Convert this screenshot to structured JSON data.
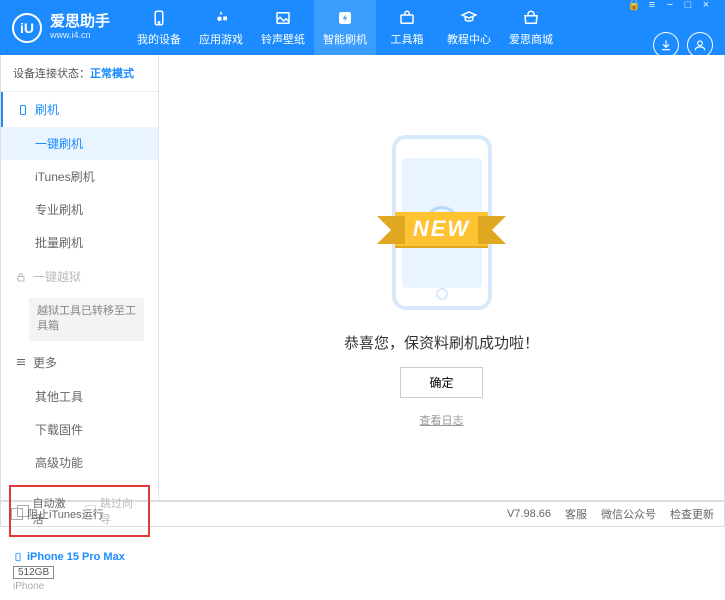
{
  "app": {
    "name": "爱思助手",
    "url": "www.i4.cn",
    "logo_letter": "iU"
  },
  "nav": [
    {
      "label": "我的设备"
    },
    {
      "label": "应用游戏"
    },
    {
      "label": "铃声壁纸"
    },
    {
      "label": "智能刷机"
    },
    {
      "label": "工具箱"
    },
    {
      "label": "教程中心"
    },
    {
      "label": "爱思商城"
    }
  ],
  "sidebar": {
    "conn_label": "设备连接状态：",
    "conn_mode": "正常模式",
    "flash_head": "刷机",
    "flash_items": [
      {
        "label": "一键刷机",
        "active": true
      },
      {
        "label": "iTunes刷机"
      },
      {
        "label": "专业刷机"
      },
      {
        "label": "批量刷机"
      }
    ],
    "jailbreak_head": "一键越狱",
    "jailbreak_note": "越狱工具已转移至工具箱",
    "more_head": "更多",
    "more_items": [
      {
        "label": "其他工具"
      },
      {
        "label": "下载固件"
      },
      {
        "label": "高级功能"
      }
    ],
    "auto_activate": "自动激活",
    "skip_guide": "跳过向导",
    "device_name": "iPhone 15 Pro Max",
    "storage": "512GB",
    "device_type": "iPhone"
  },
  "main": {
    "ribbon": "NEW",
    "success": "恭喜您，保资料刷机成功啦！",
    "ok": "确定",
    "log": "查看日志"
  },
  "status": {
    "block_itunes": "阻止iTunes运行",
    "version": "V7.98.66",
    "links": [
      "客服",
      "微信公众号",
      "检查更新"
    ]
  }
}
